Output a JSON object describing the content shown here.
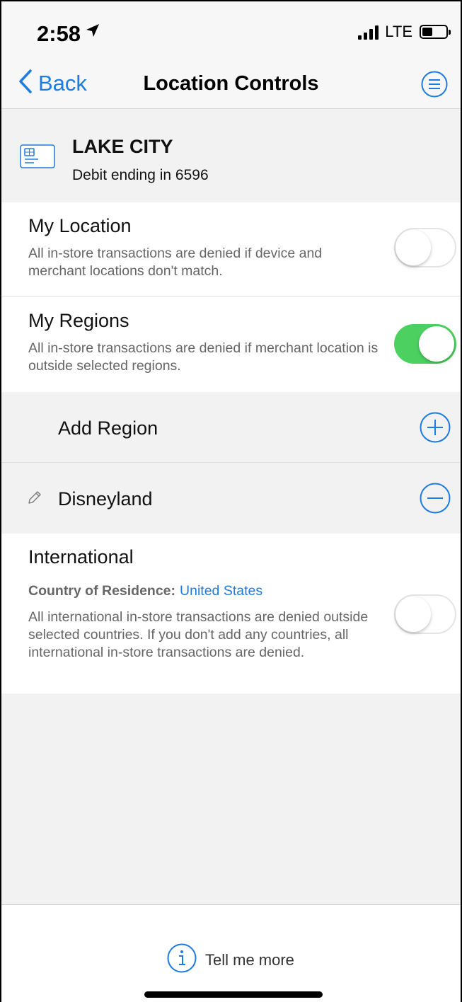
{
  "status_bar": {
    "time": "2:58",
    "network": "LTE"
  },
  "nav": {
    "back_label": "Back",
    "title": "Location Controls"
  },
  "card": {
    "name": "LAKE CITY",
    "subtitle": "Debit ending in 6596"
  },
  "my_location": {
    "title": "My Location",
    "description": "All in-store transactions are denied if device and merchant locations don't match.",
    "enabled": false
  },
  "my_regions": {
    "title": "My Regions",
    "description": "All in-store transactions are denied if merchant location is outside selected regions.",
    "enabled": true
  },
  "regions": {
    "add_label": "Add Region",
    "items": [
      {
        "label": "Disneyland"
      }
    ]
  },
  "international": {
    "title": "International",
    "residence_label": "Country of Residence:",
    "residence_value": "United States",
    "description": "All international in-store transactions are denied outside selected countries. If you don't add any countries, all international in-store transactions are denied.",
    "enabled": false
  },
  "footer": {
    "tell_more_label": "Tell me more"
  },
  "colors": {
    "accent": "#1e7be0",
    "toggle_on": "#4cd160",
    "background": "#f2f2f2"
  },
  "icons": [
    "location-arrow-icon",
    "signal-icon",
    "battery-icon",
    "chevron-left-icon",
    "menu-icon",
    "card-icon",
    "plus-circle-icon",
    "pencil-icon",
    "minus-circle-icon",
    "info-icon"
  ]
}
